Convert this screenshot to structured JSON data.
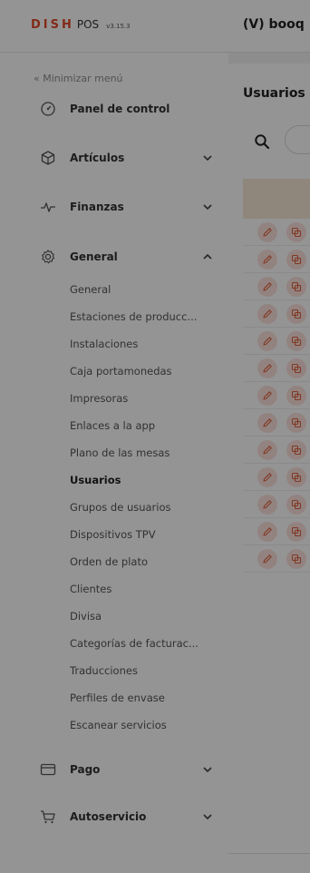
{
  "brand": {
    "name": "DISH",
    "product": "POS",
    "version": "v3.15.3"
  },
  "header": {
    "venue": "(V) booq"
  },
  "sidebar": {
    "minimize_label": "« Minimizar menú",
    "items": [
      {
        "label": "Panel de control",
        "icon": "speedometer-icon"
      },
      {
        "label": "Artículos",
        "icon": "box-icon",
        "expandable": true
      },
      {
        "label": "Finanzas",
        "icon": "pulse-icon",
        "expandable": true
      },
      {
        "label": "General",
        "icon": "gear-icon",
        "expandable": true,
        "expanded": true
      },
      {
        "label": "Pago",
        "icon": "credit-card-icon",
        "expandable": true
      },
      {
        "label": "Autoservicio",
        "icon": "cart-icon",
        "expandable": true
      }
    ],
    "general_subitems": [
      "General",
      "Estaciones de producc...",
      "Instalaciones",
      "Caja portamonedas",
      "Impresoras",
      "Enlaces a la app",
      "Plano de las mesas",
      "Usuarios",
      "Grupos de usuarios",
      "Dispositivos TPV",
      "Orden de plato",
      "Clientes",
      "Divisa",
      "Categorías de facturac...",
      "Traducciones",
      "Perfiles de envase",
      "Escanear servicios"
    ],
    "active_subitem": "Usuarios"
  },
  "main": {
    "title": "Usuarios",
    "row_count": 13,
    "row_actions": [
      "pencil-icon",
      "copy-icon"
    ]
  },
  "colors": {
    "brand_accent": "#e14b2a",
    "table_header": "#f6e9d6",
    "action_button_bg": "#fbe2dc",
    "action_icon": "#e0633f",
    "overlay": "rgba(0,0,0,0.42)"
  }
}
